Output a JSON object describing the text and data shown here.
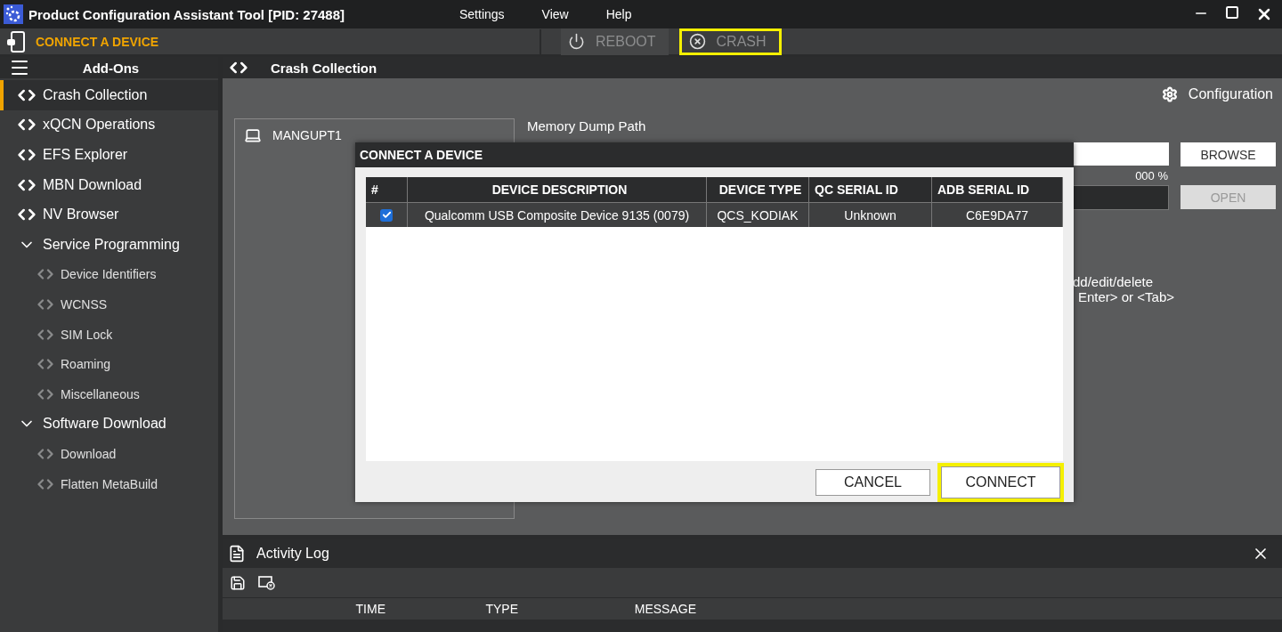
{
  "window": {
    "title": "Product Configuration Assistant Tool [PID: 27488]",
    "menu": [
      "Settings",
      "View",
      "Help"
    ]
  },
  "toolbar": {
    "connect_label": "CONNECT A DEVICE",
    "buttons": [
      {
        "label": "REBOOT",
        "kind": "power",
        "highlighted": false
      },
      {
        "label": "CRASH",
        "kind": "crash",
        "highlighted": true
      }
    ]
  },
  "sidebar": {
    "title": "Add-Ons",
    "items": [
      {
        "label": "Crash Collection",
        "kind": "module",
        "selected": true
      },
      {
        "label": "xQCN Operations",
        "kind": "module",
        "selected": false
      },
      {
        "label": "EFS Explorer",
        "kind": "module",
        "selected": false
      },
      {
        "label": "MBN Download",
        "kind": "module",
        "selected": false
      },
      {
        "label": "NV Browser",
        "kind": "module",
        "selected": false
      },
      {
        "label": "Service Programming",
        "kind": "group",
        "expanded": true,
        "children": [
          {
            "label": "Device Identifiers"
          },
          {
            "label": "WCNSS"
          },
          {
            "label": "SIM Lock"
          },
          {
            "label": "Roaming"
          },
          {
            "label": "Miscellaneous"
          }
        ]
      },
      {
        "label": "Software Download",
        "kind": "group",
        "expanded": true,
        "children": [
          {
            "label": "Download"
          },
          {
            "label": "Flatten MetaBuild"
          }
        ]
      }
    ]
  },
  "panel": {
    "title": "Crash Collection",
    "configuration": "Configuration",
    "devices": [
      "MANGUPT1"
    ],
    "memory_dump_label": "Memory Dump Path",
    "browse": "BROWSE",
    "progress_text": "000 %",
    "progress": {
      "level": 0
    },
    "open": {
      "label": "OPEN",
      "disabled": true
    },
    "hint_lines": [
      "dd/edit/delete",
      "Enter> or <Tab>"
    ]
  },
  "dialog": {
    "title": "CONNECT A DEVICE",
    "check_column": "#",
    "columns": [
      "DEVICE DESCRIPTION",
      "DEVICE TYPE",
      "QC SERIAL ID",
      "ADB SERIAL ID"
    ],
    "rows": [
      {
        "checked": true,
        "cells": [
          "Qualcomm USB Composite Device 9135 (0079)",
          "QCS_KODIAK",
          "Unknown",
          "C6E9DA77"
        ]
      }
    ],
    "buttons": [
      {
        "label": "CANCEL",
        "highlighted": false
      },
      {
        "label": "CONNECT",
        "highlighted": true
      }
    ]
  },
  "activity_log": {
    "title": "Activity Log",
    "columns": [
      "TIME",
      "TYPE",
      "MESSAGE"
    ]
  }
}
